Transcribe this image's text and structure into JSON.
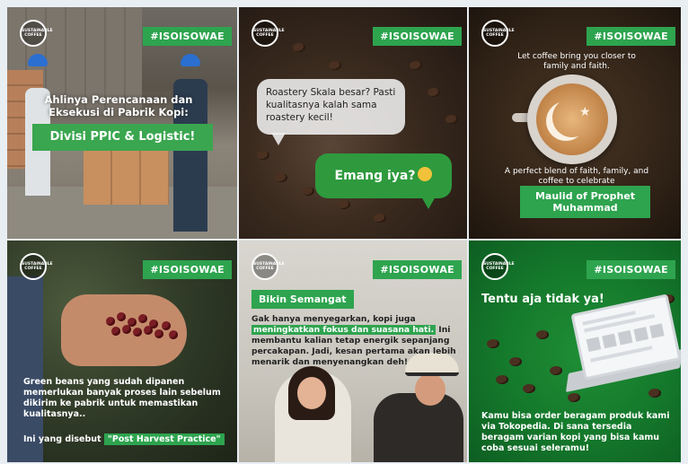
{
  "hashtag": "#ISOISOWAE",
  "logo_text": "SUSTAINABLE COFFEE",
  "tiles": {
    "t1": {
      "heading": "Ahlinya Perencanaan dan Eksekusi di Pabrik Kopi:",
      "box": "Divisi PPIC & Logistic!"
    },
    "t2": {
      "bubble1": "Roastery Skala besar? Pasti kualitasnya kalah sama roastery kecil!",
      "bubble2": "Emang iya?"
    },
    "t3": {
      "top": "Let coffee bring you closer to family and faith.",
      "mid": "A perfect blend of faith, family, and coffee to celebrate",
      "box_line1": "Maulid of Prophet",
      "box_line2": "Muhammad"
    },
    "t4": {
      "body": "Green beans yang sudah dipanen memerlukan banyak proses lain sebelum dikirim ke pabrik untuk memastikan kualitasnya..",
      "line_prefix": "Ini yang disebut",
      "line_highlight": "\"Post Harvest Practice\""
    },
    "t5": {
      "heading": "Bikin Semangat",
      "body_part1": "Gak hanya menyegarkan, kopi juga ",
      "body_highlight": "meningkatkan fokus dan suasana hati.",
      "body_part2": " Ini membantu kalian tetap energik sepanjang percakapan. Jadi, kesan pertama akan lebih menarik dan menyenangkan deh!"
    },
    "t6": {
      "heading": "Tentu aja tidak ya!",
      "body": "Kamu bisa order beragam produk kami via Tokopedia. Di sana tersedia beragam varian kopi yang bisa kamu coba sesuai seleramu!"
    }
  },
  "colors": {
    "accent_green": "#2ea44f",
    "background": "#e9eef3"
  },
  "icons": [
    "brand-logo-icon",
    "thinking-face-emoji-icon",
    "crescent-star-icon",
    "laptop-icon"
  ]
}
